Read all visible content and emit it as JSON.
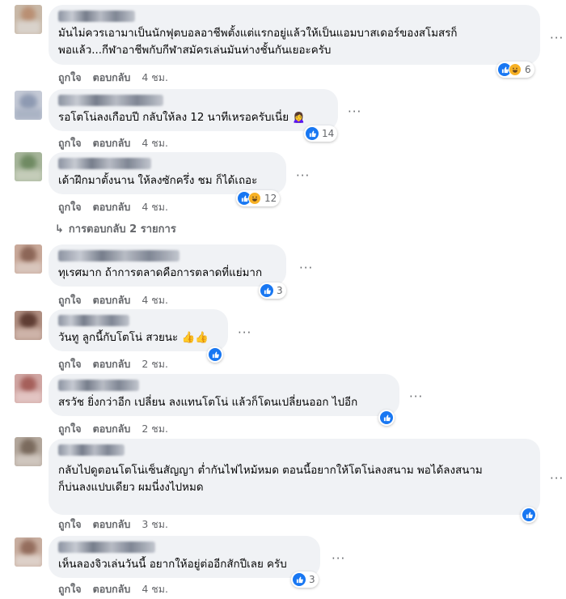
{
  "labels": {
    "like": "ถูกใจ",
    "reply": "ตอบกลับ",
    "more": "···"
  },
  "colors": {
    "bubble": "#f0f2f5",
    "like_blue": "#1877f2",
    "haha_yellow": "#f7b125",
    "meta_gray": "#65676b"
  },
  "comments": [
    {
      "text": "มันไม่ควรเอามาเป็นนักฟุตบอลอาชีพตั้งแต่แรกอยู่แล้วให้เป็นแอมบาสเดอร์ของสโมสรก็\nพอแล้ว...กีฬาอาชีพกับกีฬาสมัครเล่นมันห่างชั้นกันเยอะครับ",
      "time": "4 ชม.",
      "reactions": {
        "types": [
          "like",
          "haha"
        ],
        "count": "6"
      }
    },
    {
      "text": "รอโตโน่ลงเกือบปี กลับให้ลง 12 นาทีเหรอครับเนี่ย 🙍‍♀️",
      "time": "4 ชม.",
      "reactions": {
        "types": [
          "like"
        ],
        "count": "14"
      }
    },
    {
      "text": "เด้าฝึกมาตั้งนาน ให้ลงซักครึ่ง ชม ก็ได้เถอะ",
      "time": "4 ชม.",
      "reactions": {
        "types": [
          "like",
          "haha"
        ],
        "count": "12"
      },
      "replies_label": "การตอบกลับ 2 รายการ"
    },
    {
      "text": "ทุเรศมาก ถ้าการตลาดคือการตลาดที่แย่มาก",
      "time": "4 ชม.",
      "reactions": {
        "types": [
          "like"
        ],
        "count": "3"
      }
    },
    {
      "text": "วันทู ลูกนี้กับโตโน่ สวยนะ 👍👍",
      "time": "2 ชม.",
      "reactions": {
        "types": [
          "like"
        ],
        "count": ""
      }
    },
    {
      "text": "สรวัช ยิ่งกว่าอีก เปลี่ยน ลงแทนโตโน่ แล้วก็โดนเปลี่ยนออก ไปอีก",
      "time": "2 ชม.",
      "reactions": {
        "types": [
          "like"
        ],
        "count": ""
      }
    },
    {
      "text": "กลับไปดูตอนโตโน่เซ็นสัญญา ต่ำกันไฟไหม้หมด ตอนนี้อยากให้โตโน่ลงสนาม พอได้ลงสนาม\nก็บ่นลงแปบเดียว ผมนี่งงไปหมด",
      "time": "3 ชม.",
      "reactions": {
        "types": [
          "like"
        ],
        "count": ""
      }
    },
    {
      "text": "เห็นลองจิวเล่นวันนี้ อยากให้อยู่ต่ออีกสักปีเลย ครับ",
      "time": "4 ชม.",
      "reactions": {
        "types": [
          "like"
        ],
        "count": "3"
      }
    }
  ]
}
